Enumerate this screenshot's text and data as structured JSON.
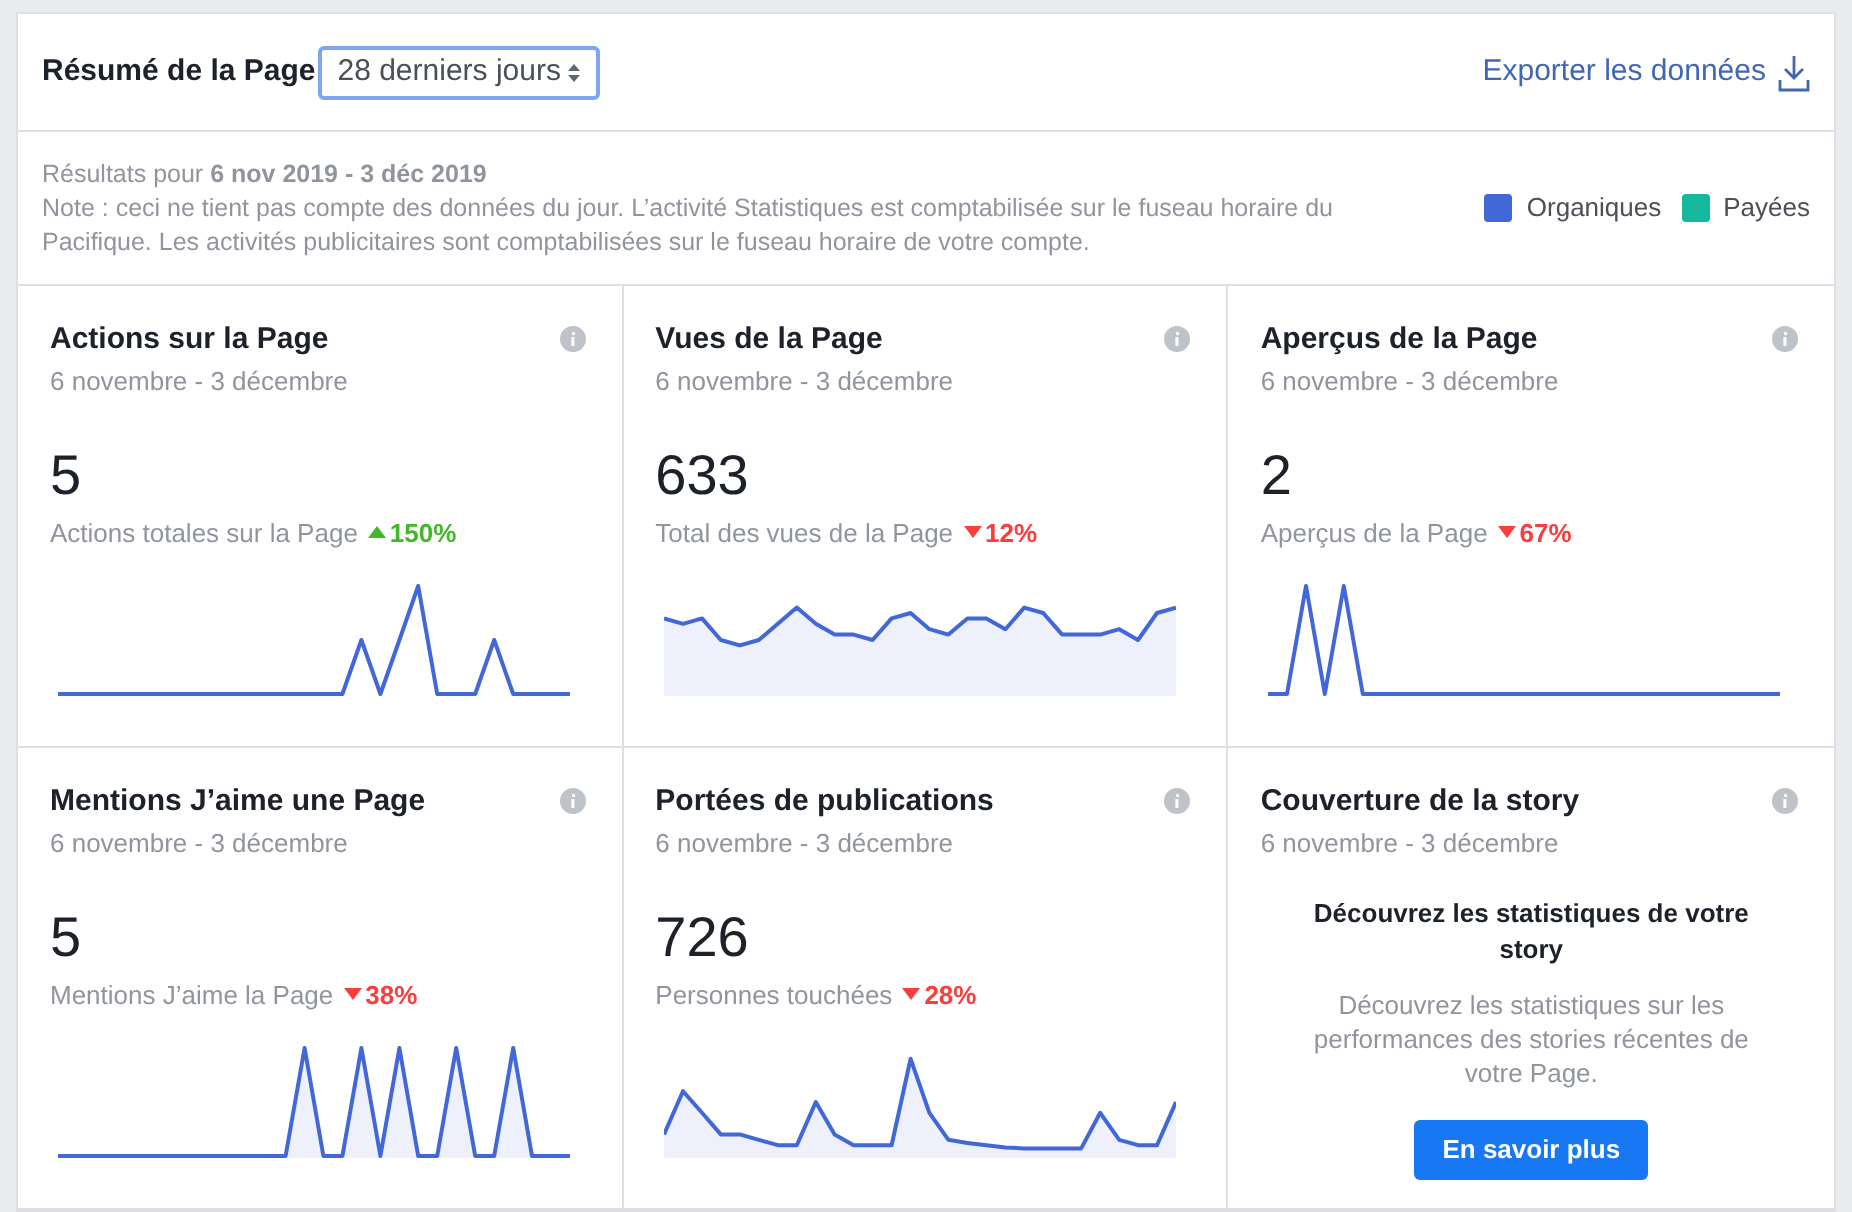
{
  "header": {
    "title": "Résumé de la Page",
    "period": "28 derniers jours",
    "export": "Exporter les données"
  },
  "notice": {
    "results": "Résultats pour **6 nov 2019 - 3 déc 2019**",
    "note": "Note : ceci ne tient pas compte des données du jour. L’activité Statistiques est comptabilisée sur le fuseau horaire du Pacifique. Les activités publicitaires sont comptabilisées sur le fuseau horaire de votre compte."
  },
  "legend": [
    {
      "label": "Organiques",
      "color": "#4267d6"
    },
    {
      "label": "Payées",
      "color": "#17b8a0"
    }
  ],
  "cards": [
    {
      "kind": "metric",
      "title": "Actions sur la Page",
      "range": "6 novembre - 3 décembre",
      "value": "5",
      "caption": "Actions totales sur la Page",
      "increase": true,
      "change": "150%"
    },
    {
      "kind": "metric",
      "title": "Vues de la Page",
      "range": "6 novembre - 3 décembre",
      "value": "633",
      "caption": "Total des vues de la Page",
      "increase": false,
      "change": "12%"
    },
    {
      "kind": "metric",
      "title": "Aperçus de la Page",
      "range": "6 novembre - 3 décembre",
      "value": "2",
      "caption": "Aperçus de la Page",
      "increase": false,
      "change": "67%"
    },
    {
      "kind": "metric",
      "title": "Mentions J’aime une Page",
      "range": "6 novembre - 3 décembre",
      "value": "5",
      "caption": "Mentions J’aime la Page",
      "increase": false,
      "change": "38%"
    },
    {
      "kind": "metric",
      "title": "Portées de publications",
      "range": "6 novembre - 3 décembre",
      "value": "726",
      "caption": "Personnes touchées",
      "increase": false,
      "change": "28%"
    },
    {
      "kind": "promo",
      "title": "Couverture de la story",
      "range": "6 novembre - 3 décembre",
      "heading": "Découvrez les statistiques de votre story",
      "text": "Découvrez les statistiques sur les performances des stories récentes de votre Page.",
      "button": "En savoir plus"
    }
  ]
}
